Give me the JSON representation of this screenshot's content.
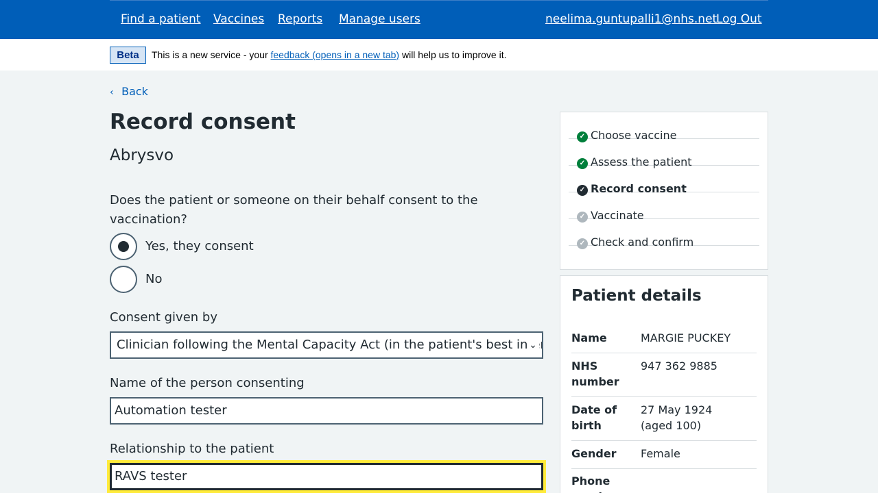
{
  "header": {
    "nav": [
      "Find a patient",
      "Vaccines",
      "Reports",
      "Manage users"
    ],
    "user_email": "neelima.guntupalli1@nhs.net",
    "logout": "Log Out"
  },
  "beta": {
    "tag": "Beta",
    "text_before": "This is a new service - your ",
    "link": "feedback (opens in a new tab)",
    "text_after": " will help us to improve it."
  },
  "back_link": "Back",
  "page_title": "Record consent",
  "vaccine": "Abrysvo",
  "consent_question": "Does the patient or someone on their behalf consent to the vaccination?",
  "consent_options": [
    {
      "label": "Yes, they consent",
      "selected": true
    },
    {
      "label": "No",
      "selected": false
    }
  ],
  "consent_given_by": {
    "label": "Consent given by",
    "value": "Clinician following the Mental Capacity Act (in the patient's best interest)"
  },
  "person_consenting": {
    "label": "Name of the person consenting",
    "value": "Automation tester"
  },
  "relationship": {
    "label": "Relationship to the patient",
    "value": "RAVS tester"
  },
  "steps": [
    {
      "label": "Choose vaccine",
      "status": "done"
    },
    {
      "label": "Assess the patient",
      "status": "done"
    },
    {
      "label": "Record consent",
      "status": "current"
    },
    {
      "label": "Vaccinate",
      "status": "pending"
    },
    {
      "label": "Check and confirm",
      "status": "pending"
    }
  ],
  "patient": {
    "title": "Patient details",
    "details": [
      {
        "key": "Name",
        "value": "MARGIE PUCKEY"
      },
      {
        "key": "NHS number",
        "value": "947 362 9885"
      },
      {
        "key": "Date of birth",
        "value": "27 May 1924 (aged 100)"
      },
      {
        "key": "Gender",
        "value": "Female"
      },
      {
        "key": "Phone number",
        "value": ""
      }
    ]
  },
  "colors": {
    "brand_blue": "#005eb8",
    "done_green": "#007f3b",
    "current": "#212b32",
    "pending_grey": "#aeb7bd",
    "focus_yellow": "#ffeb3b"
  }
}
